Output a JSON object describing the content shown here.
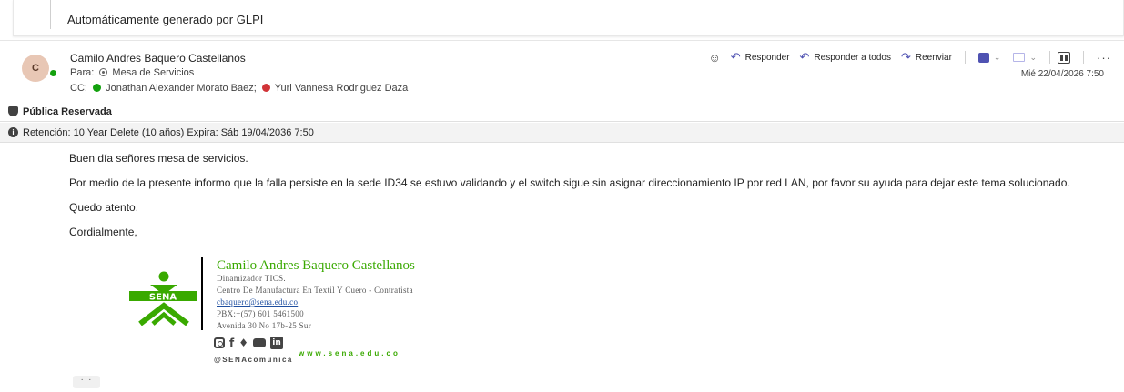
{
  "notice": {
    "text": "Automáticamente generado por GLPI"
  },
  "message": {
    "sender_initial": "C",
    "sender_name": "Camilo Andres Baquero Castellanos",
    "to_label": "Para:",
    "to_recipient": "Mesa de Servicios",
    "cc_label": "CC:",
    "cc": [
      {
        "name": "Jonathan Alexander Morato Baez;",
        "status_color": "#13a10e"
      },
      {
        "name": "Yuri Vannesa Rodriguez Daza",
        "status_color": "#d13438"
      }
    ],
    "date": "Mié 22/04/2026 7:50"
  },
  "actions": {
    "reply": "Responder",
    "reply_all": "Responder a todos",
    "forward": "Reenviar",
    "more": "···"
  },
  "labels": {
    "sensitivity": "Pública Reservada",
    "retention": "Retención: 10 Year Delete (10 años) Expira: Sáb 19/04/2036 7:50"
  },
  "body": {
    "greeting": "Buen día señores mesa de servicios.",
    "paragraph": "Por medio de la presente informo que la falla persiste en la sede ID34 se estuvo validando y el switch sigue sin asignar direccionamiento IP por red LAN, por favor su ayuda para dejar este tema solucionado.",
    "closing": "Quedo atento.",
    "signoff": "Cordialmente,"
  },
  "signature": {
    "logo_text": "SENA",
    "name": "Camilo Andres Baquero Castellanos",
    "role": "Dinamizador TICS.",
    "center": "Centro De Manufactura En Textil Y Cuero - Contratista",
    "email": "cbaquero@sena.edu.co",
    "phone": "PBX:+(57) 601 5461500",
    "address": "Avenida 30 No 17b-25 Sur",
    "handle": "@SENAcomunica",
    "website": "www.sena.edu.co",
    "brand_color": "#39a900"
  },
  "footer": {
    "expand": "···"
  }
}
